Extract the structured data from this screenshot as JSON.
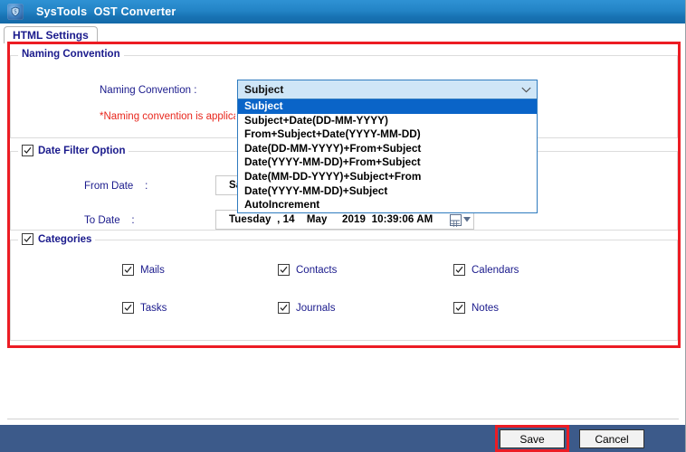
{
  "window": {
    "title": "SysTools  OST Converter",
    "icon": "app-shield-icon"
  },
  "tabs": [
    {
      "label": "HTML Settings",
      "active": true
    }
  ],
  "naming_convention_group": {
    "title": "Naming Convention",
    "field_label": "Naming Convention :",
    "warning_text": "*Naming convention is applica",
    "combo": {
      "selected": "Subject",
      "expanded": true,
      "arrow_icon": "chevron-down-icon",
      "options": [
        "Subject",
        "Subject+Date(DD-MM-YYYY)",
        "From+Subject+Date(YYYY-MM-DD)",
        "Date(DD-MM-YYYY)+From+Subject",
        "Date(YYYY-MM-DD)+From+Subject",
        "Date(MM-DD-YYYY)+Subject+From",
        "Date(YYYY-MM-DD)+Subject",
        "AutoIncrement"
      ]
    }
  },
  "date_filter_group": {
    "title": "Date Filter Option",
    "checked": true,
    "from_date": {
      "label": "From Date    :",
      "value": "Sat",
      "picker_icon": "calendar-icon"
    },
    "to_date": {
      "label": "To Date    :",
      "value": "Tuesday  , 14    May     2019  10:39:06 AM",
      "picker_icon": "calendar-icon"
    }
  },
  "categories_group": {
    "title": "Categories",
    "checked": true,
    "items": [
      {
        "label": "Mails",
        "checked": true
      },
      {
        "label": "Contacts",
        "checked": true
      },
      {
        "label": "Calendars",
        "checked": true
      },
      {
        "label": "Tasks",
        "checked": true
      },
      {
        "label": "Journals",
        "checked": true
      },
      {
        "label": "Notes",
        "checked": true
      }
    ]
  },
  "footer": {
    "save_label": "Save",
    "cancel_label": "Cancel"
  },
  "colors": {
    "titlebar_blue": "#2384c6",
    "footer_blue": "#3c5a8a",
    "highlight_red": "#ec1c24",
    "label_navy": "#1a1a8c",
    "warning_red": "#e8261c",
    "combo_select_blue": "#0a64c8"
  }
}
